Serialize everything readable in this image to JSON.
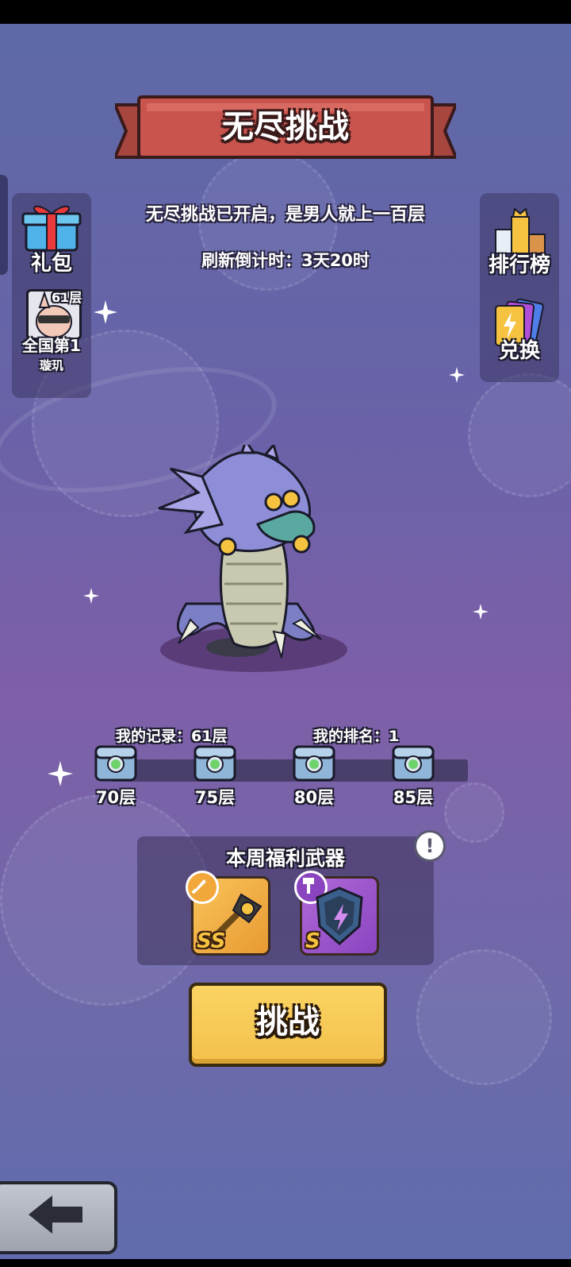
{
  "header": {
    "title": "无尽挑战"
  },
  "info": {
    "announcement": "无尽挑战已开启，是男人就上一百层",
    "countdown": "刷新倒计时：3天20时"
  },
  "left_panel": {
    "gift_label": "礼包",
    "top_player": {
      "floor": "61层",
      "rank_title": "全国第1",
      "name": "璇玑"
    }
  },
  "right_panel": {
    "leaderboard_label": "排行榜",
    "exchange_label": "兑换"
  },
  "progress": {
    "my_record": "我的记录：61层",
    "my_rank": "我的排名：1",
    "milestones": [
      {
        "label": "70层"
      },
      {
        "label": "75层"
      },
      {
        "label": "80层"
      },
      {
        "label": "85层"
      }
    ]
  },
  "weapons": {
    "title": "本周福利武器",
    "items": [
      {
        "grade": "SS",
        "type_icon": "sword-icon",
        "image": "golden-staff"
      },
      {
        "grade": "S",
        "type_icon": "hammer-icon",
        "image": "lightning-shield"
      }
    ]
  },
  "actions": {
    "challenge_label": "挑战"
  },
  "colors": {
    "button_yellow": "#f3c04b",
    "banner_red": "#c9534d",
    "chest_gem": "#6fd36b"
  }
}
